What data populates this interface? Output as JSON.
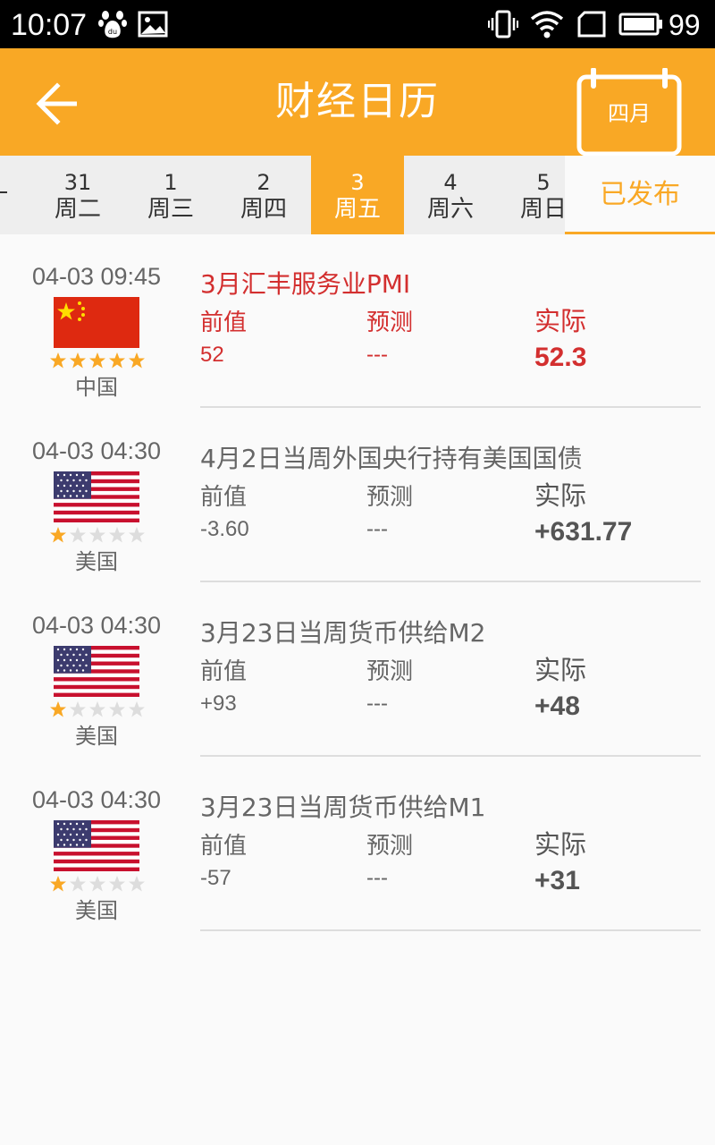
{
  "status_bar": {
    "time": "10:07",
    "battery": "99"
  },
  "header": {
    "title": "财经日历",
    "calendar_month": "四月"
  },
  "tabs": [
    {
      "date": "31",
      "weekday": "周二"
    },
    {
      "date": "1",
      "weekday": "周三"
    },
    {
      "date": "2",
      "weekday": "周四"
    },
    {
      "date": "3",
      "weekday": "周五"
    },
    {
      "date": "4",
      "weekday": "周六"
    },
    {
      "date": "5",
      "weekday": "周日"
    }
  ],
  "active_tab": "3",
  "published_label": "已发布",
  "colors": {
    "accent": "#f9a825",
    "highlight": "#d32f2f"
  },
  "labels": {
    "previous": "前值",
    "forecast": "预测",
    "actual": "实际"
  },
  "events": [
    {
      "time": "04-03 09:45",
      "country": "中国",
      "flag": "china-flag-icon",
      "stars": 5,
      "title": "3月汇丰服务业PMI",
      "previous": "52",
      "forecast": "---",
      "actual": "52.3"
    },
    {
      "time": "04-03 04:30",
      "country": "美国",
      "flag": "usa-flag-icon",
      "stars": 1,
      "title": "4月2日当周外国央行持有美国国债",
      "previous": "-3.60",
      "forecast": "---",
      "actual": "+631.77"
    },
    {
      "time": "04-03 04:30",
      "country": "美国",
      "flag": "usa-flag-icon",
      "stars": 1,
      "title": "3月23日当周货币供给M2",
      "previous": "+93",
      "forecast": "---",
      "actual": "+48"
    },
    {
      "time": "04-03 04:30",
      "country": "美国",
      "flag": "usa-flag-icon",
      "stars": 1,
      "title": "3月23日当周货币供给M1",
      "previous": "-57",
      "forecast": "---",
      "actual": "+31"
    }
  ]
}
